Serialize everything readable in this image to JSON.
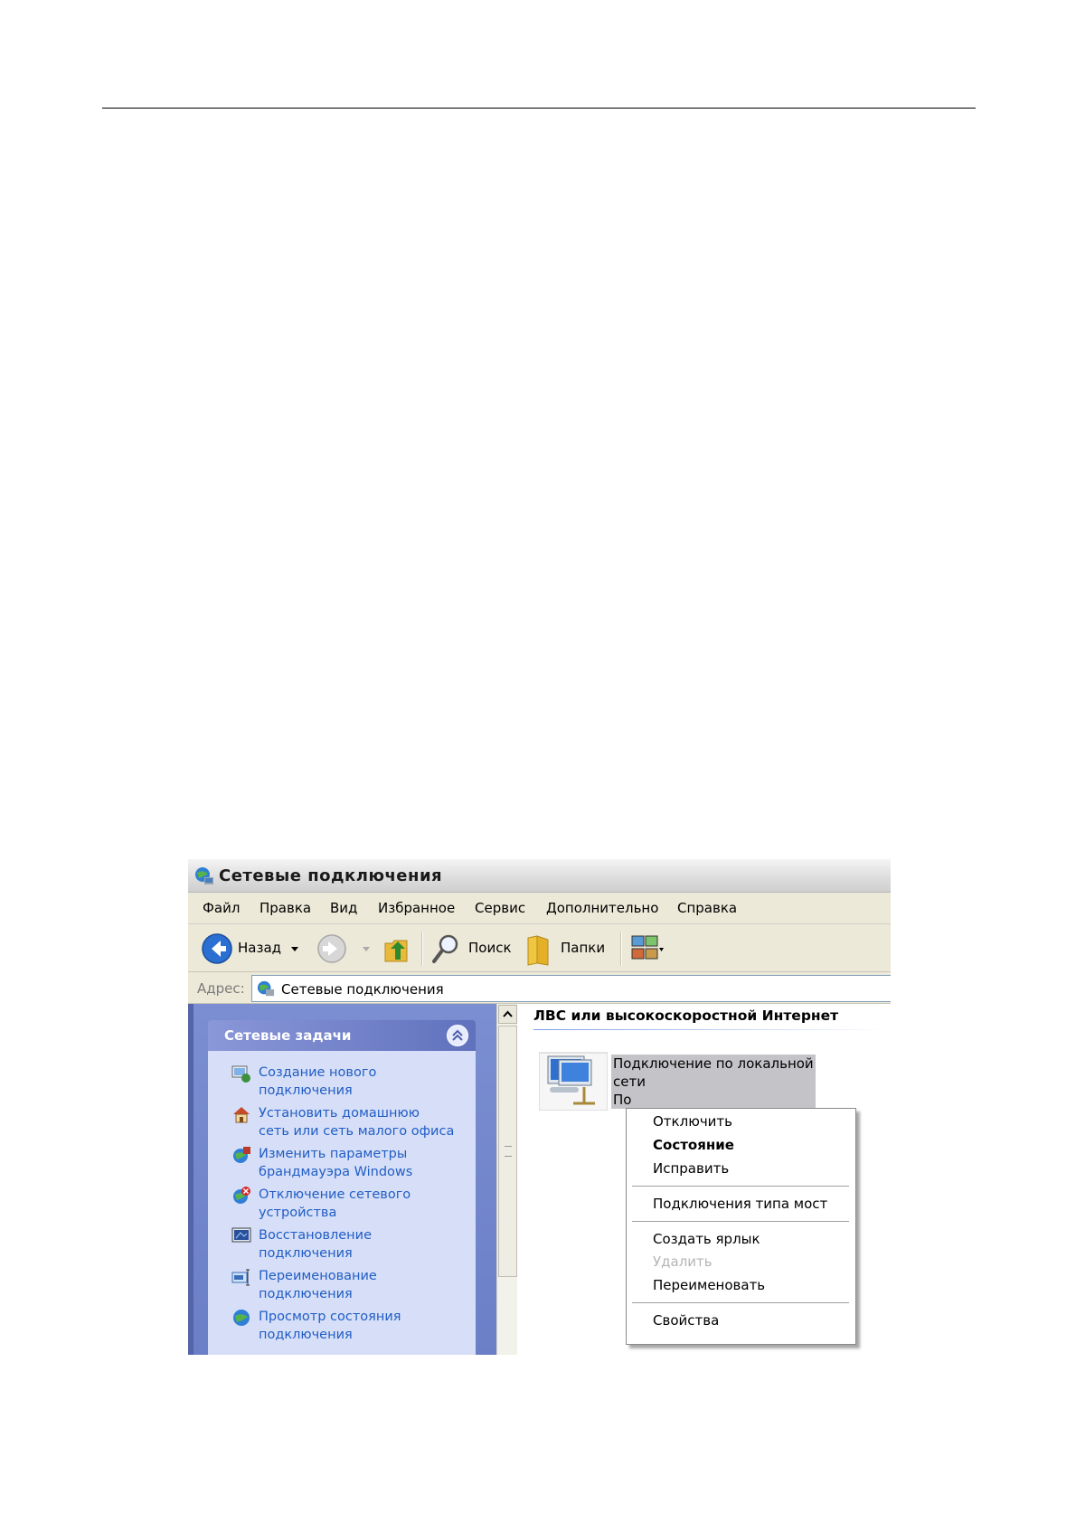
{
  "window": {
    "title": "Сетевые подключения"
  },
  "menubar": [
    "Файл",
    "Правка",
    "Вид",
    "Избранное",
    "Сервис",
    "Дополнительно",
    "Справка"
  ],
  "toolbar": {
    "back_label": "Назад",
    "search_label": "Поиск",
    "folders_label": "Папки"
  },
  "address": {
    "label": "Адрес:",
    "value": "Сетевые подключения"
  },
  "tasks": {
    "title": "Сетевые задачи",
    "items": [
      {
        "line1": "Создание нового",
        "line2": "подключения",
        "icon": "new-connection-icon"
      },
      {
        "line1": "Установить домашнюю",
        "line2": "сеть или сеть малого офиса",
        "icon": "home-network-icon"
      },
      {
        "line1": "Изменить параметры",
        "line2": "брандмауэра Windows",
        "icon": "firewall-icon"
      },
      {
        "line1": "Отключение сетевого",
        "line2": "устройства",
        "icon": "disable-device-icon"
      },
      {
        "line1": "Восстановление",
        "line2": "подключения",
        "icon": "repair-icon"
      },
      {
        "line1": "Переименование",
        "line2": "подключения",
        "icon": "rename-icon"
      },
      {
        "line1": "Просмотр состояния",
        "line2": "подключения",
        "icon": "view-status-icon"
      }
    ]
  },
  "content": {
    "group_title": "ЛВС или высокоскоростной Интернет",
    "connection": {
      "line1": "Подключение по локальной",
      "line2": "сети",
      "line3": "По"
    }
  },
  "context_menu": {
    "disconnect": "Отключить",
    "status": "Состояние",
    "repair": "Исправить",
    "bridge": "Подключения типа мост",
    "shortcut": "Создать ярлык",
    "delete": "Удалить",
    "rename": "Переименовать",
    "properties": "Свойства"
  },
  "colors": {
    "task_link": "#215dc6",
    "task_pane": "#6b7fc8",
    "menu_bg": "#ece9d8"
  }
}
